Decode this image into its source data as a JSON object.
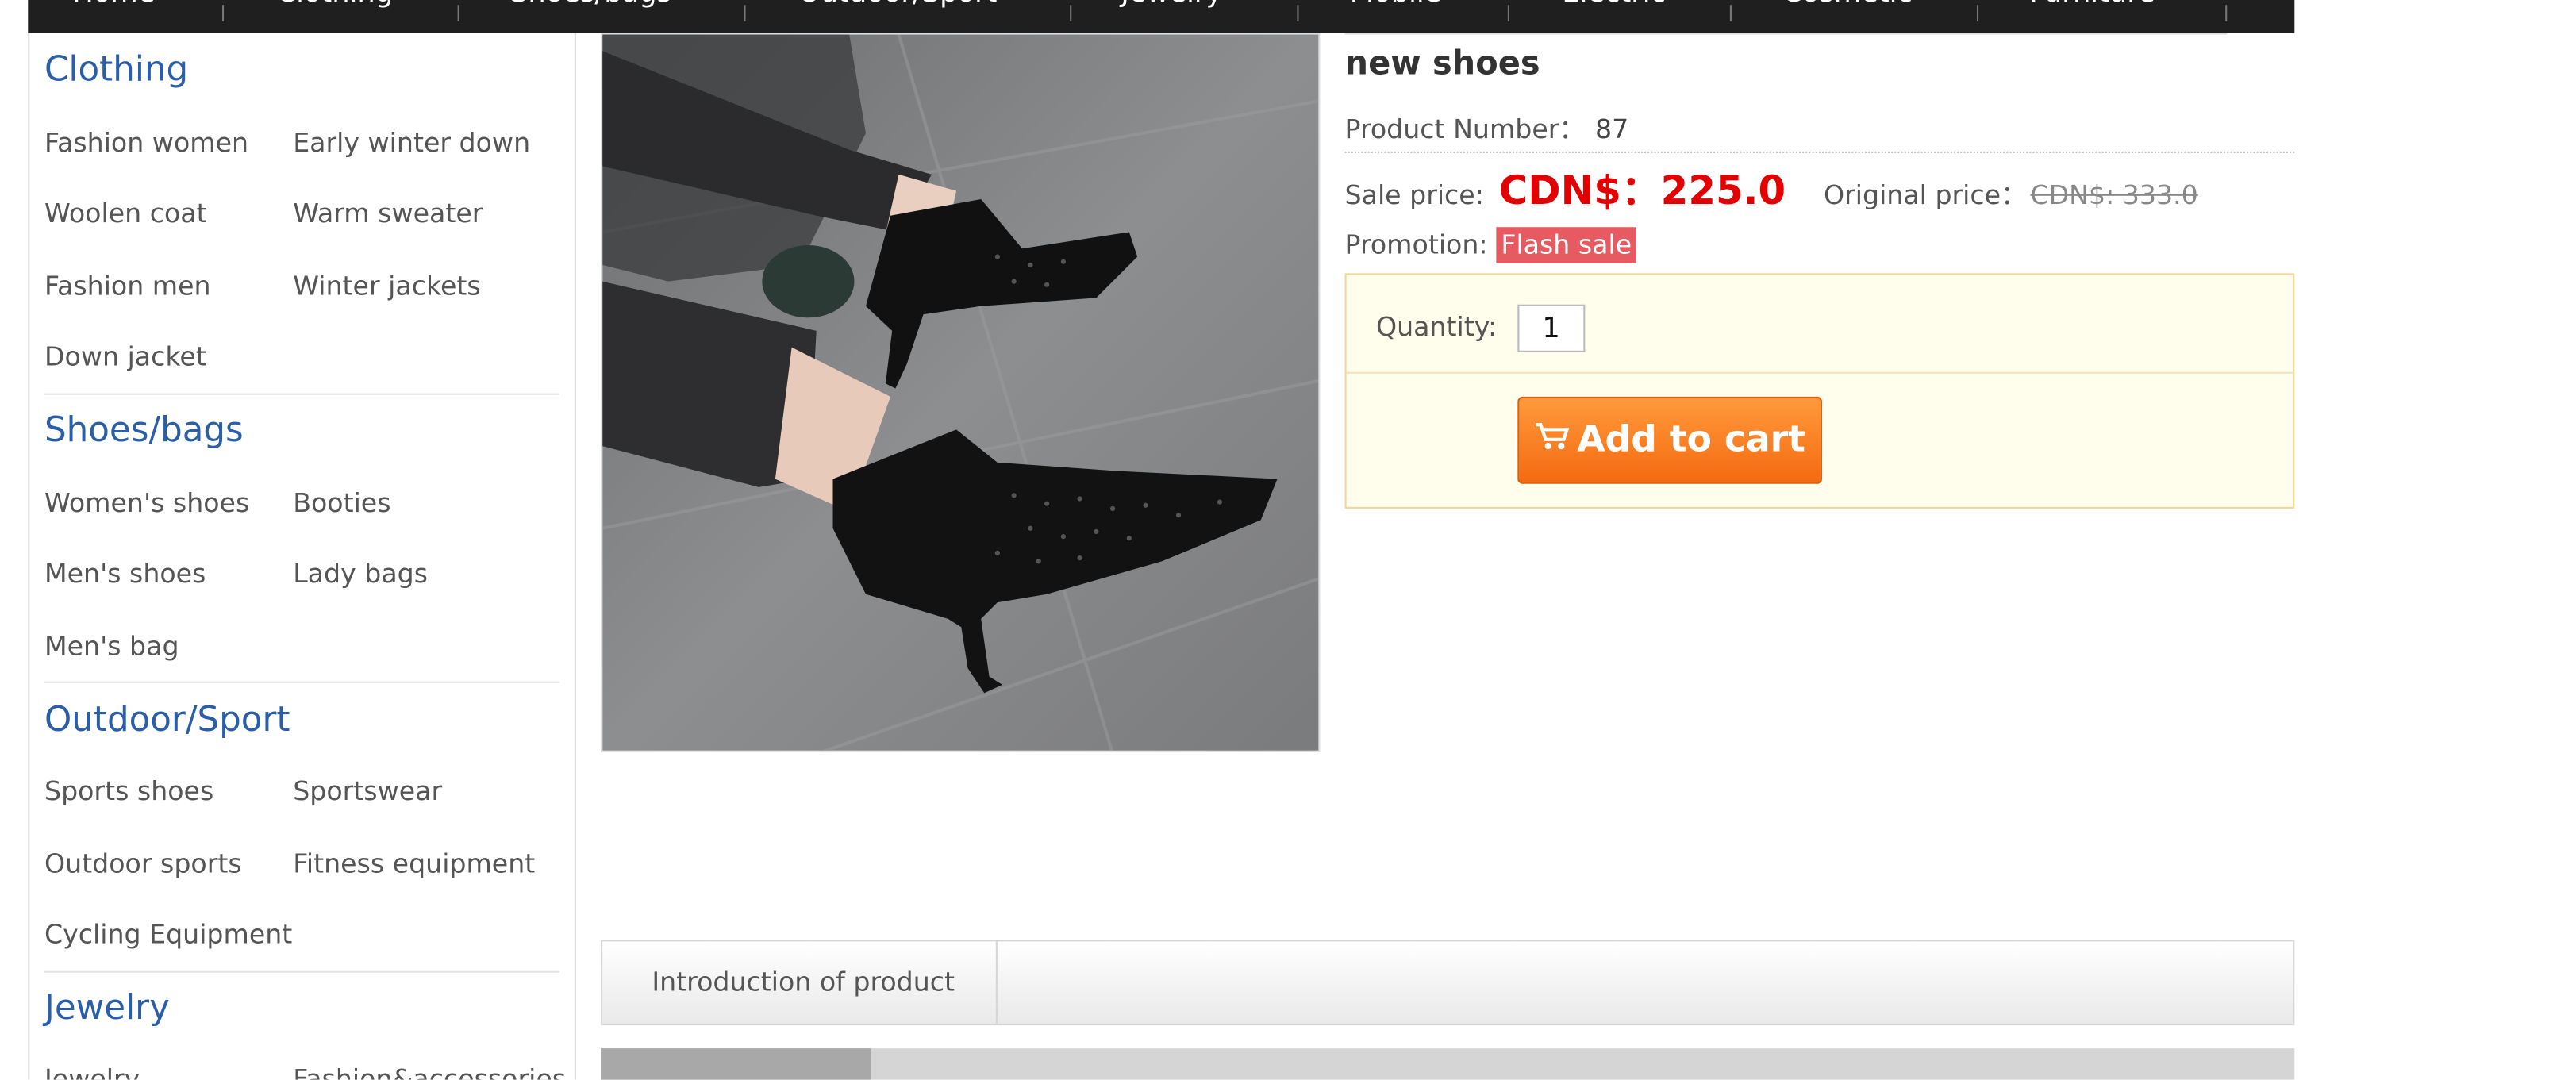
{
  "top_nav": {
    "items": [
      "Home",
      "Clothing",
      "Shoes/bags",
      "Outdoor/Sport",
      "Jewelry",
      "Mobile",
      "Electric",
      "Cosmetic",
      "Furniture"
    ]
  },
  "sidebar": {
    "categories": [
      {
        "title": "Clothing",
        "items": [
          "Fashion women",
          "Early winter down",
          "Woolen coat",
          "Warm sweater",
          "Fashion men",
          "Winter jackets",
          "Down jacket"
        ]
      },
      {
        "title": "Shoes/bags",
        "items": [
          "Women's shoes",
          "Booties",
          "Men's shoes",
          "Lady bags",
          "Men's bag"
        ]
      },
      {
        "title": "Outdoor/Sport",
        "items": [
          "Sports shoes",
          "Sportswear",
          "Outdoor sports",
          "Fitness equipment",
          "Cycling Equipment"
        ]
      },
      {
        "title": "Jewelry",
        "items": [
          "Jewelry",
          "Fashion&accessories"
        ]
      }
    ]
  },
  "product": {
    "name": "new shoes",
    "number_label": "Product Number：",
    "number": "87",
    "sale_label": "Sale price:",
    "sale_price": "CDN$：225.0",
    "original_label": "Original price：",
    "original_price": "CDN$: 333.0",
    "promotion_label": "Promotion:",
    "promotion": "Flash sale",
    "quantity_label": "Quantity:",
    "quantity": "1",
    "add_to_cart": "Add to cart",
    "image_icon": "ankle-boot-photo"
  },
  "tabs": {
    "intro": "Introduction of product"
  },
  "colors": {
    "link_blue": "#2a5ea8",
    "sale_red": "#e30000",
    "promo_badge": "#e85a62",
    "cart_orange": "#f56a10",
    "buy_box_bg": "#fffdeb",
    "nav_bg": "#1f1f1f"
  }
}
